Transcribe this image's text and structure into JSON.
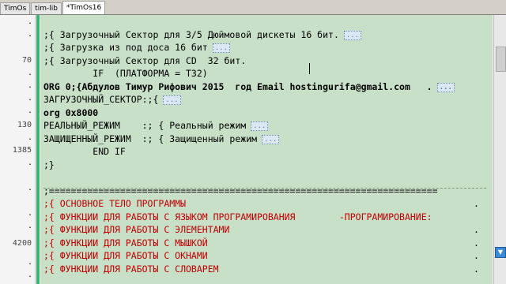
{
  "tabs": [
    {
      "label": "TimOs"
    },
    {
      "label": "tim-lib"
    },
    {
      "label": "*TimOs16"
    }
  ],
  "gutter": {
    "numbers": [
      "70",
      "130",
      "1385",
      "4200"
    ]
  },
  "editor": {
    "lines": [
      {
        "text": ";{ Загрузочный Сектор для 3/5 Дюймовой дискеты 16 бит.",
        "fold": "..."
      },
      {
        "text": ";{ Загрузка из под доса 16 бит",
        "fold": "..."
      },
      {
        "text": ";{ Загрузочный Сектор для CD  32 бит.",
        "fold": ""
      },
      {
        "text": "         IF  (ПЛАТФОРМА = T32)",
        "fold": ""
      },
      {
        "text": "ORG 0;{Абдулов Тимур Рифович 2015  год Email hostingurifa@gmail.com   .",
        "fold": "..."
      },
      {
        "text": "ЗАГРУЗОЧНЫЙ_СЕКТОР:;{",
        "fold": "..."
      },
      {
        "text": "org 0x8000",
        "fold": ""
      },
      {
        "text": "РЕАЛЬНЫЙ_РЕЖИМ    :; { Реальный режим",
        "fold": "..."
      },
      {
        "text": "ЗАЩИЩЕННЫЙ_РЕЖИМ  :; { Защищенный режим",
        "fold": "..."
      },
      {
        "text": "         END IF",
        "fold": ""
      },
      {
        "text": ";}",
        "fold": ""
      }
    ],
    "separator": ";=======================================================================",
    "section_lines": [
      ";{ ОСНОВНОЕ ТЕЛО ПРОГРАММЫ",
      ";{ ФУНКЦИИ ДЛЯ РАБОТЫ С ЯЗЫКОМ ПРОГРАМИРОВАНИЯ        -ПРОГРАМИРОВАНИЕ:",
      ";{ ФУНКЦИИ ДЛЯ РАБОТЫ С ЭЛЕМЕНТАМИ",
      ";{ ФУНКЦИИ ДЛЯ РАБОТЫ С МЫШКОЙ",
      ";{ ФУНКЦИИ ДЛЯ РАБОТЫ С ОКНАМИ",
      ";{ ФУНКЦИИ ДЛЯ РАБОТЫ С СЛОВАРЕМ"
    ],
    "dot": "."
  },
  "colors": {
    "editor_bg": "#c8dfc8",
    "mark_bar": "#3cb371",
    "accent_semicolon": "#c00000"
  }
}
